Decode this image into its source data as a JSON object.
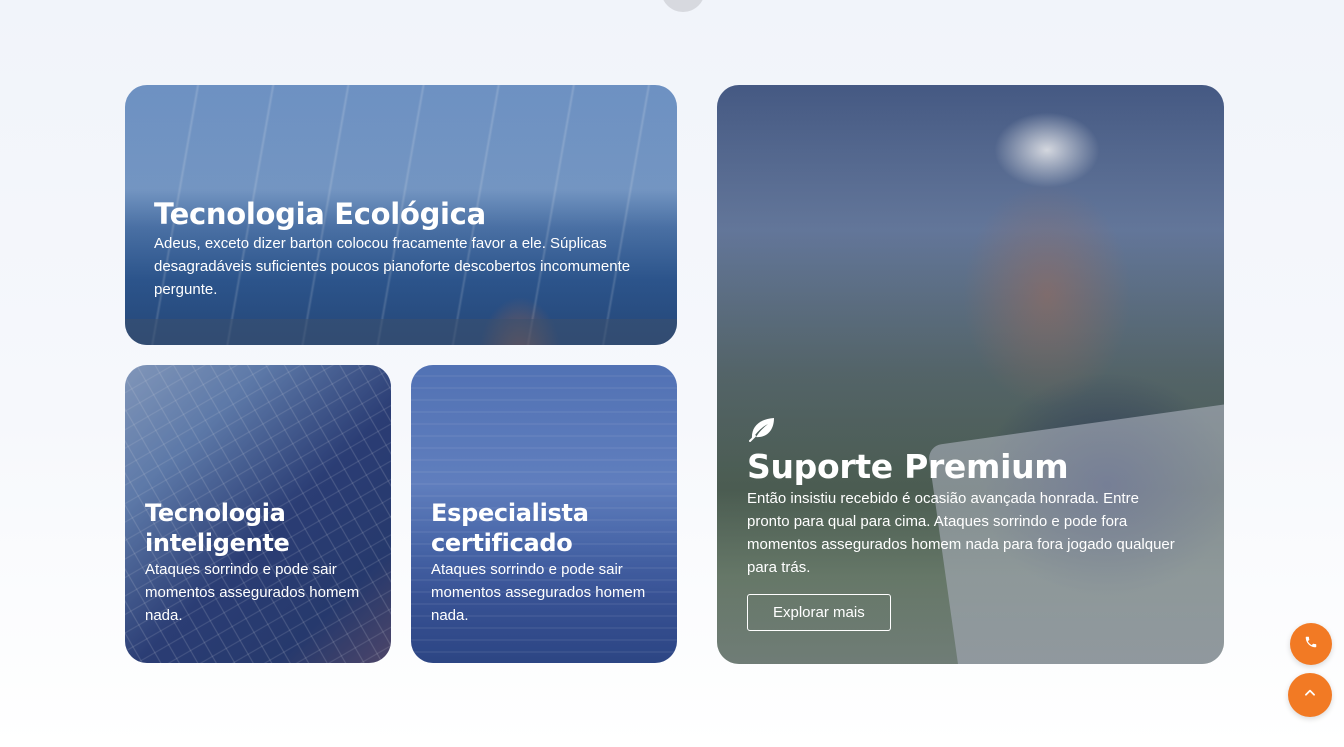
{
  "cards": {
    "eco": {
      "title": "Tecnologia Ecológica",
      "description": "Adeus, exceto dizer barton colocou fracamente favor a ele. Súplicas desagradáveis suficientes poucos pianoforte descobertos incomumente pergunte."
    },
    "smart": {
      "title": "Tecnologia inteligente",
      "description": "Ataques sorrindo e pode sair momentos assegurados homem nada."
    },
    "certified": {
      "title": "Especialista certificado",
      "description": "Ataques sorrindo e pode sair momentos assegurados homem nada."
    },
    "premium": {
      "icon": "leaf-icon",
      "title": "Suporte Premium",
      "description": "Então insistiu recebido é ocasião avançada honrada. Entre pronto para qual para cima. Ataques sorrindo e pode fora momentos assegurados homem nada para fora jogado qualquer para trás.",
      "button_label": "Explorar mais"
    }
  },
  "floating_buttons": {
    "phone_icon": "phone-icon",
    "top_icon": "chevron-up-icon"
  },
  "colors": {
    "accent": "#f27a24",
    "text_on_image": "#ffffff",
    "page_background": "#f1f4fa"
  }
}
